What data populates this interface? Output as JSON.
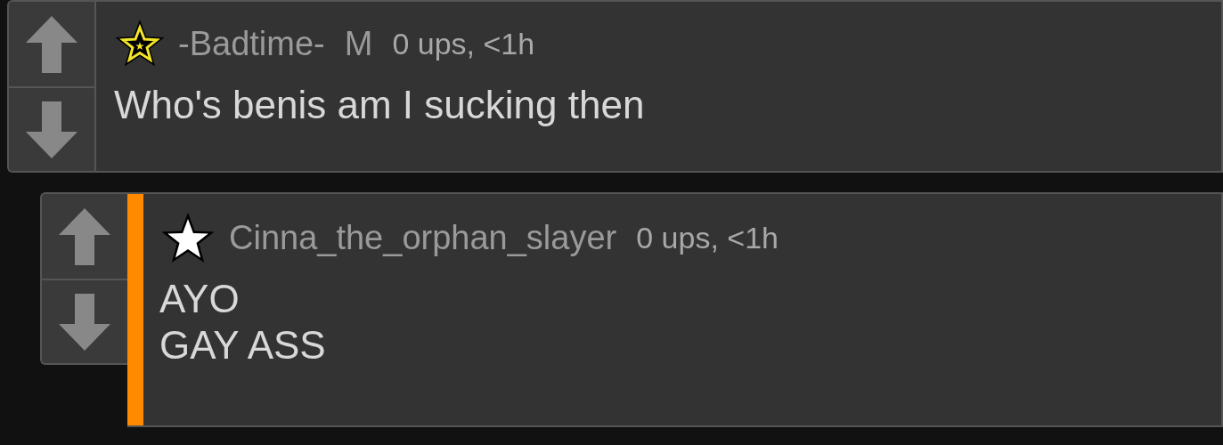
{
  "comments": [
    {
      "username": "-Badtime-",
      "kind": "gold",
      "flair": "M",
      "meta": "0 ups, <1h",
      "highlighted": false,
      "lines": [
        "Who's benis am I sucking then"
      ],
      "replies": [
        {
          "username": "Cinna_the_orphan_slayer",
          "kind": "plain",
          "meta": "0 ups, <1h",
          "highlighted": true,
          "lines": [
            "AYO",
            "GAY ASS"
          ]
        }
      ]
    }
  ]
}
